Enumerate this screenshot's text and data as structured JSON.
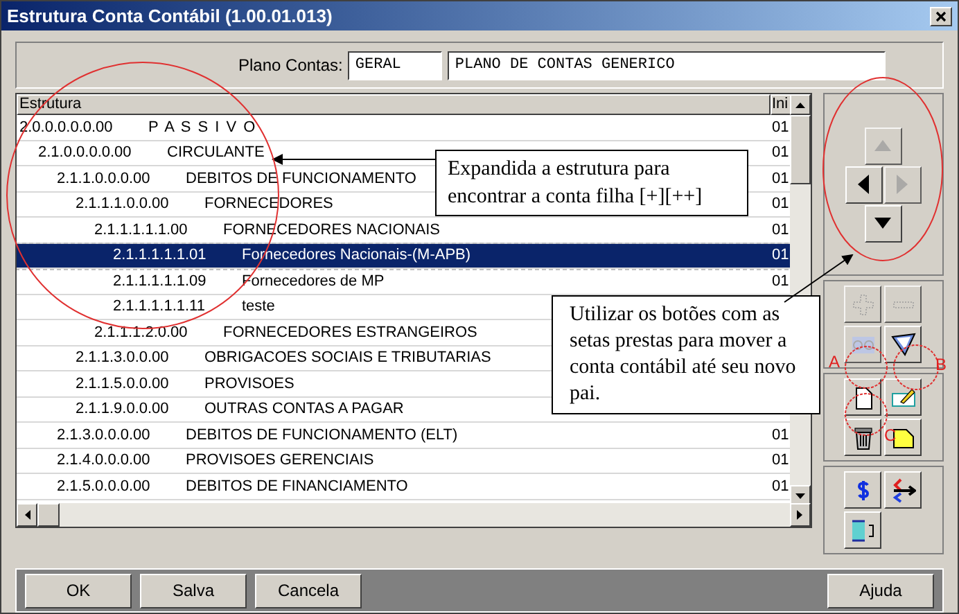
{
  "window": {
    "title": "Estrutura Conta Contábil (1.00.01.013)"
  },
  "plano": {
    "label": "Plano Contas:",
    "code": "GERAL",
    "description": "PLANO DE CONTAS GENERICO"
  },
  "table": {
    "columns": [
      "Estrutura",
      "Ini"
    ],
    "rows": [
      {
        "code": "2.0.0.0.0.0.00",
        "name": "P A S S I V O",
        "column_2": "01",
        "selected": false,
        "children": [
          {
            "code": "2.1.0.0.0.0.00",
            "name": "CIRCULANTE",
            "column_2": "01",
            "selected": false,
            "children": [
              {
                "code": "2.1.1.0.0.0.00",
                "name": "DEBITOS DE FUNCIONAMENTO",
                "column_2": "01",
                "selected": false,
                "children": [
                  {
                    "code": "2.1.1.1.0.0.00",
                    "name": "FORNECEDORES",
                    "column_2": "01",
                    "selected": false,
                    "children": [
                      {
                        "code": "2.1.1.1.1.1.00",
                        "name": "FORNECEDORES NACIONAIS",
                        "column_2": "01",
                        "selected": false,
                        "children": [
                          {
                            "code": "2.1.1.1.1.1.01",
                            "name": "Fornecedores Nacionais-(M-APB)",
                            "column_2": "01",
                            "selected": true
                          },
                          {
                            "code": "2.1.1.1.1.1.09",
                            "name": "Fornecedores de MP",
                            "column_2": "01",
                            "selected": false
                          },
                          {
                            "code": "2.1.1.1.1.1.11",
                            "name": "teste",
                            "selected": false
                          }
                        ]
                      },
                      {
                        "code": "2.1.1.1.2.0.00",
                        "name": "FORNECEDORES ESTRANGEIROS",
                        "selected": false
                      }
                    ]
                  },
                  {
                    "code": "2.1.1.3.0.0.00",
                    "name": "OBRIGACOES SOCIAIS E TRIBUTARIAS",
                    "selected": false
                  },
                  {
                    "code": "2.1.1.5.0.0.00",
                    "name": "PROVISOES",
                    "selected": false
                  },
                  {
                    "code": "2.1.1.9.0.0.00",
                    "name": "OUTRAS CONTAS A PAGAR",
                    "selected": false
                  }
                ]
              },
              {
                "code": "2.1.3.0.0.0.00",
                "name": "DEBITOS DE FUNCIONAMENTO (ELT)",
                "column_2": "01",
                "selected": false
              },
              {
                "code": "2.1.4.0.0.0.00",
                "name": "PROVISOES GERENCIAIS",
                "column_2": "01",
                "selected": false
              },
              {
                "code": "2.1.5.0.0.0.00",
                "name": "DEBITOS DE FINANCIAMENTO",
                "column_2": "01",
                "selected": false
              }
            ]
          }
        ]
      }
    ]
  },
  "toolbar": [
    {
      "kind": "nav",
      "buttons": [
        {
          "kind": "up",
          "disabled": true
        },
        {
          "kind": "left",
          "disabled": false
        },
        {
          "kind": "right",
          "disabled": true
        },
        {
          "kind": "down",
          "disabled": false
        }
      ]
    },
    {
      "kind": "grid",
      "buttons": [
        {
          "kind": "plus",
          "disabled": true
        },
        {
          "kind": "minus",
          "disabled": true
        },
        {
          "kind": "expand",
          "disabled": true
        },
        {
          "kind": "funnel",
          "disabled": false
        }
      ]
    },
    {
      "kind": "grid",
      "buttons": [
        {
          "kind": "new",
          "disabled": false
        },
        {
          "kind": "edit",
          "disabled": false
        },
        {
          "kind": "trash",
          "disabled": false
        },
        {
          "kind": "note",
          "disabled": false
        }
      ]
    },
    {
      "kind": "grid",
      "buttons": [
        {
          "kind": "dollar",
          "disabled": false
        },
        {
          "kind": "swap",
          "disabled": false
        },
        {
          "kind": "columns",
          "disabled": false
        }
      ]
    }
  ],
  "annotations": {
    "callout_1": "Expandida a estrutura para encontrar a conta filha [+][++]",
    "callout_2": "Utilizar os botões com as setas prestas para mover a conta contábil até seu novo pai.",
    "labels": [
      "A",
      "B",
      "C"
    ]
  },
  "buttons": [
    {
      "label": "OK"
    },
    {
      "label": "Salva"
    },
    {
      "label": "Cancela"
    }
  ],
  "help_button": {
    "label": "Ajuda"
  }
}
